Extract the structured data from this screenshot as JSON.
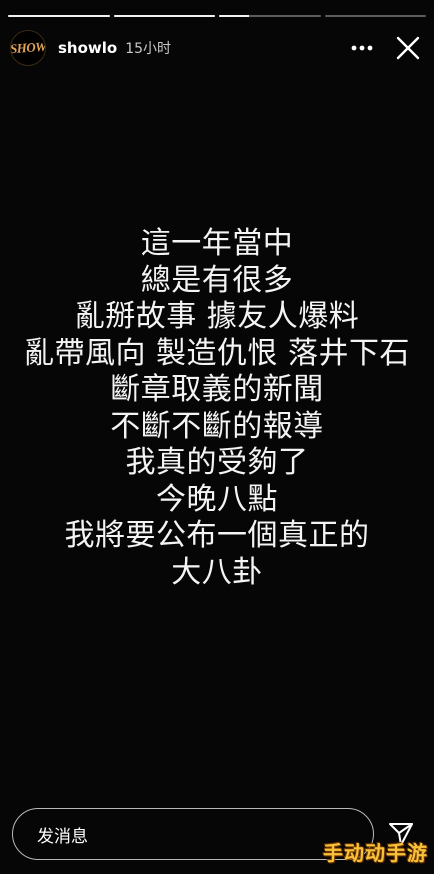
{
  "progress": {
    "segments": [
      1,
      1,
      0.3,
      0
    ]
  },
  "header": {
    "avatar_logo": "SHOW",
    "username": "showlo",
    "timestamp": "15小时",
    "more_icon": "more-horizontal-icon",
    "close_icon": "close-icon"
  },
  "story": {
    "lines": [
      "這一年當中",
      "總是有很多",
      "亂掰故事 據友人爆料",
      "亂帶風向 製造仇恨 落井下石",
      "斷章取義的新聞",
      "不斷不斷的報導",
      "我真的受夠了",
      "今晚八點",
      "我將要公布一個真正的",
      "大八卦"
    ]
  },
  "reply": {
    "placeholder": "发消息",
    "send_icon": "send-icon"
  },
  "watermark": "手动动手游",
  "colors": {
    "background": "#060606",
    "text": "#f4f4f4",
    "avatar_logo": "#e0a35a",
    "watermark": "#f6c23a"
  }
}
